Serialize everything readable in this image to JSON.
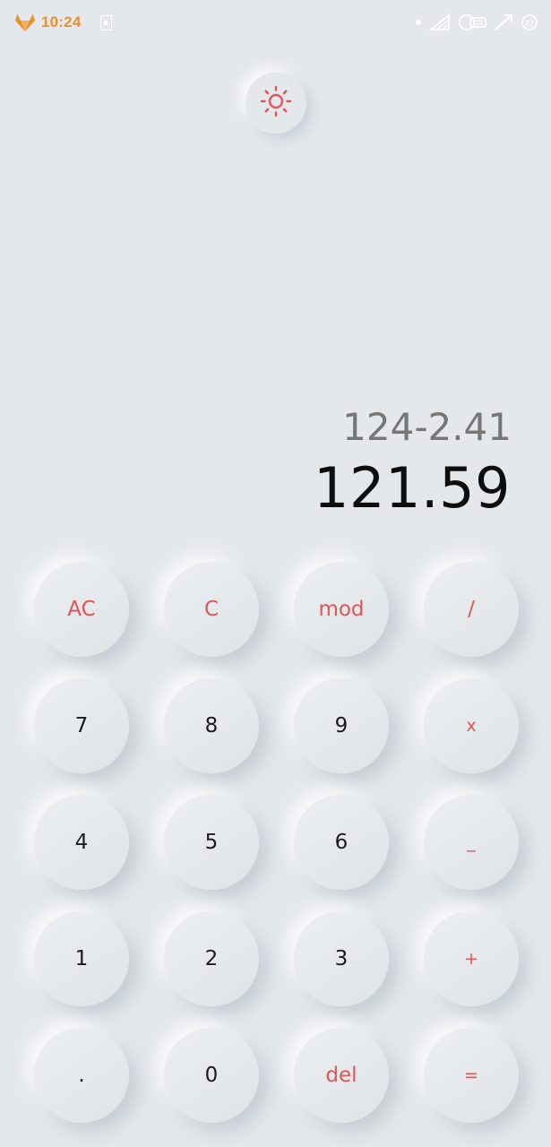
{
  "status_bar": {
    "time": "10:24",
    "app_icon": "gitlab-fox-icon",
    "notification_icon": "sim-card-icon",
    "right_icons": [
      "dot-icon",
      "wifi-icon",
      "vowifi-icon",
      "signal-icon",
      "battery-icon"
    ],
    "battery_level": "22"
  },
  "theme_toggle": {
    "icon": "sun-icon"
  },
  "display": {
    "expression": "124-2.41",
    "result": "121.59"
  },
  "keypad": {
    "rows": [
      [
        {
          "label": "AC",
          "name": "all-clear"
        },
        {
          "label": "C",
          "name": "clear"
        },
        {
          "label": "mod",
          "name": "modulo"
        },
        {
          "label": "/",
          "name": "divide"
        }
      ],
      [
        {
          "label": "7",
          "name": "7"
        },
        {
          "label": "8",
          "name": "8"
        },
        {
          "label": "9",
          "name": "9"
        },
        {
          "label": "x",
          "name": "multiply"
        }
      ],
      [
        {
          "label": "4",
          "name": "4"
        },
        {
          "label": "5",
          "name": "5"
        },
        {
          "label": "6",
          "name": "6"
        },
        {
          "label": "_",
          "name": "subtract"
        }
      ],
      [
        {
          "label": "1",
          "name": "1"
        },
        {
          "label": "2",
          "name": "2"
        },
        {
          "label": "3",
          "name": "3"
        },
        {
          "label": "+",
          "name": "add"
        }
      ],
      [
        {
          "label": ".",
          "name": "decimal"
        },
        {
          "label": "0",
          "name": "0"
        },
        {
          "label": "del",
          "name": "delete"
        },
        {
          "label": "=",
          "name": "equals"
        }
      ]
    ]
  },
  "colors": {
    "background": "#e4e8eb",
    "accent": "#e05555",
    "digit_text": "#1b1b1b",
    "expression_text": "#767676",
    "result_text": "#0d0d0d",
    "clock": "#e8912b"
  }
}
